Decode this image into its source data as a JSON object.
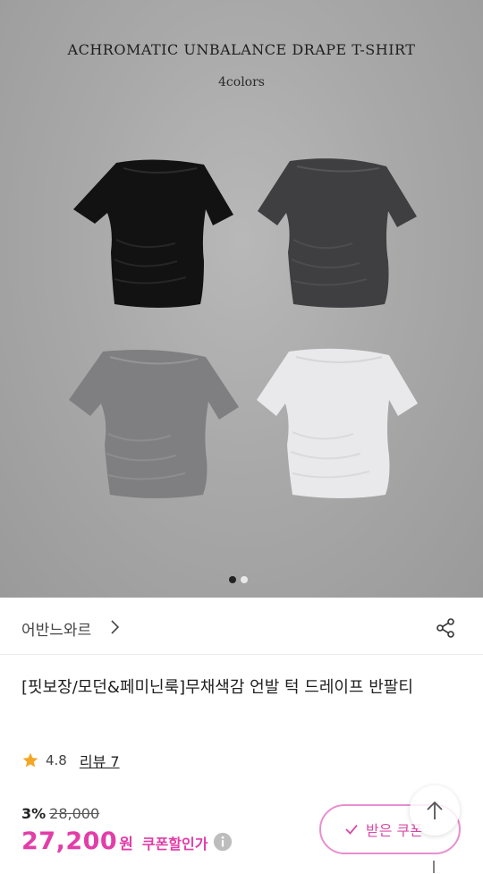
{
  "hero": {
    "title": "ACHROMATIC UNBALANCE DRAPE T-SHIRT",
    "subtitle": "4colors",
    "shirt_colors": [
      "#121212",
      "#3f3f41",
      "#7f7f81",
      "#e9e9eb"
    ],
    "carousel": {
      "current": 1,
      "total": 2
    }
  },
  "brand": {
    "name": "어반느와르",
    "chevron_icon": "chevron-right-icon",
    "share_icon": "share-icon"
  },
  "product": {
    "title": "[핏보장/모던&페미닌룩]무채색감 언발 턱 드레이프 반팔티"
  },
  "rating": {
    "value": "4.8",
    "review_label": "리뷰 7",
    "star_color": "#f5a623"
  },
  "price": {
    "discount_rate": "3%",
    "original": "28,000",
    "current": "27,200",
    "unit": "원",
    "coupon_label": "쿠폰할인가",
    "accent_color": "#e23ea8"
  },
  "coupon_button": {
    "label": "받은 쿠폰"
  },
  "scroll_top": {
    "icon": "arrow-up-icon"
  }
}
